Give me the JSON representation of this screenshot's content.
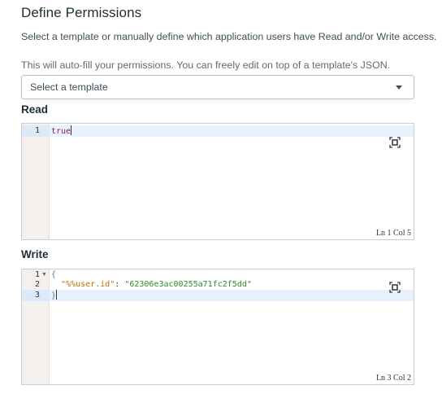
{
  "header": {
    "title": "Define Permissions",
    "description": "Select a template or manually define which application users have Read and/or Write access.",
    "hint": "This will auto-fill your permissions. You can freely edit on top of a template's JSON."
  },
  "template_select": {
    "placeholder": "Select a template",
    "icon": "chevron-down-icon"
  },
  "read": {
    "label": "Read",
    "lines": [
      {
        "number": "1",
        "text": "true"
      }
    ],
    "status": "Ln 1 Col 5",
    "expand_icon": "expand-icon"
  },
  "write": {
    "label": "Write",
    "lines": [
      {
        "number": "1",
        "text": "{"
      },
      {
        "number": "2",
        "key": "\"%%user.id\"",
        "separator": ": ",
        "value": "\"62306e3ac00255a71fc2f5dd\""
      },
      {
        "number": "3",
        "text": "}"
      }
    ],
    "status": "Ln 3 Col 2",
    "expand_icon": "expand-icon"
  },
  "colors": {
    "accent_highlight": "#e8f2fe",
    "keyword": "#8a1e6a",
    "string_key": "#c66b12",
    "string_value": "#2f8a2f"
  }
}
